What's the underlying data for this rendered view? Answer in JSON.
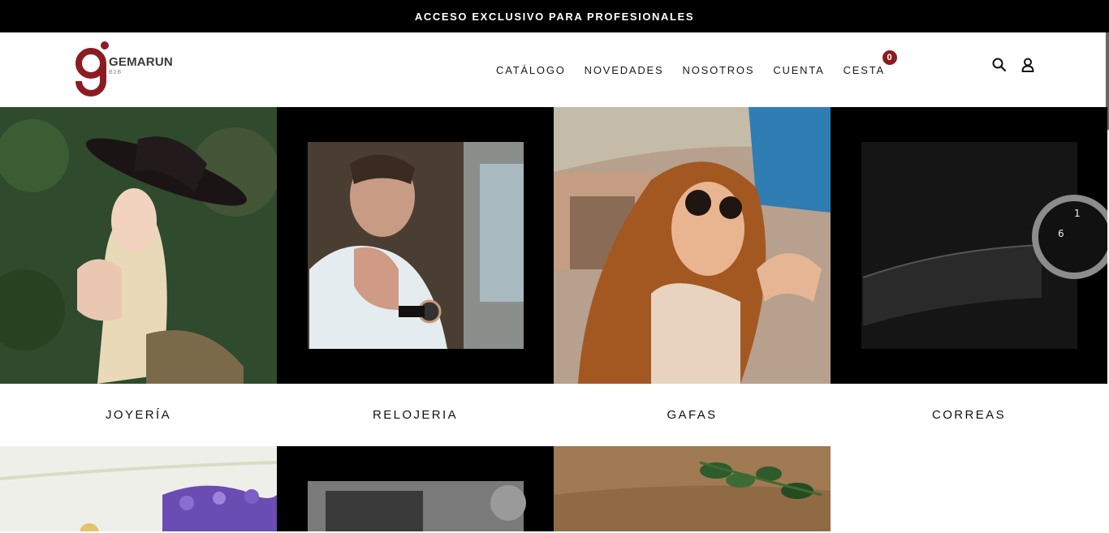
{
  "topbar": {
    "text": "ACCESO EXCLUSIVO PARA PROFESIONALES"
  },
  "logo": {
    "brand": "GEMARUN",
    "sub": "B2B",
    "color": "#8c1c22"
  },
  "nav": {
    "items": [
      {
        "label": "CATÁLOGO"
      },
      {
        "label": "NOVEDADES"
      },
      {
        "label": "NOSOTROS"
      },
      {
        "label": "CUENTA"
      },
      {
        "label": "CESTA"
      }
    ],
    "cart_count": "0",
    "icons": [
      "search-icon",
      "user-icon"
    ]
  },
  "categories": [
    {
      "label": "JOYERÍA"
    },
    {
      "label": "RELOJERIA"
    },
    {
      "label": "GAFAS"
    },
    {
      "label": "CORREAS"
    }
  ]
}
